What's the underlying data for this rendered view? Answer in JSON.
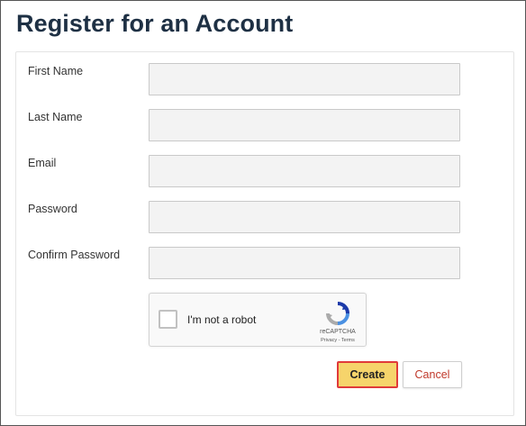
{
  "page": {
    "title": "Register for an Account"
  },
  "form": {
    "fields": [
      {
        "label": "First Name",
        "value": ""
      },
      {
        "label": "Last Name",
        "value": ""
      },
      {
        "label": "Email",
        "value": ""
      },
      {
        "label": "Password",
        "value": ""
      },
      {
        "label": "Confirm Password",
        "value": ""
      }
    ],
    "recaptcha": {
      "checkbox_label": "I'm not a robot",
      "brand": "reCAPTCHA",
      "links": "Privacy - Terms",
      "icon": "recaptcha-logo-icon"
    },
    "buttons": {
      "create_label": "Create",
      "cancel_label": "Cancel"
    }
  },
  "colors": {
    "title": "#1e3044",
    "input_background": "#f3f3f3",
    "create_button": "#f6d46b",
    "create_highlight_border": "#e03a3a",
    "cancel_text": "#c0392b"
  }
}
